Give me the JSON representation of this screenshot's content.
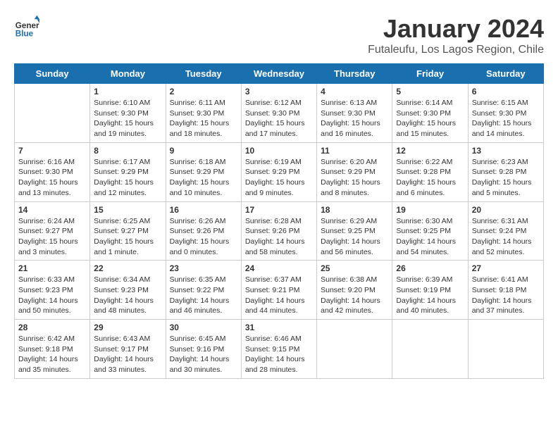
{
  "logo": {
    "general": "General",
    "blue": "Blue"
  },
  "title": "January 2024",
  "subtitle": "Futaleufu, Los Lagos Region, Chile",
  "days_of_week": [
    "Sunday",
    "Monday",
    "Tuesday",
    "Wednesday",
    "Thursday",
    "Friday",
    "Saturday"
  ],
  "weeks": [
    [
      {
        "day": "",
        "info": ""
      },
      {
        "day": "1",
        "info": "Sunrise: 6:10 AM\nSunset: 9:30 PM\nDaylight: 15 hours\nand 19 minutes."
      },
      {
        "day": "2",
        "info": "Sunrise: 6:11 AM\nSunset: 9:30 PM\nDaylight: 15 hours\nand 18 minutes."
      },
      {
        "day": "3",
        "info": "Sunrise: 6:12 AM\nSunset: 9:30 PM\nDaylight: 15 hours\nand 17 minutes."
      },
      {
        "day": "4",
        "info": "Sunrise: 6:13 AM\nSunset: 9:30 PM\nDaylight: 15 hours\nand 16 minutes."
      },
      {
        "day": "5",
        "info": "Sunrise: 6:14 AM\nSunset: 9:30 PM\nDaylight: 15 hours\nand 15 minutes."
      },
      {
        "day": "6",
        "info": "Sunrise: 6:15 AM\nSunset: 9:30 PM\nDaylight: 15 hours\nand 14 minutes."
      }
    ],
    [
      {
        "day": "7",
        "info": "Sunrise: 6:16 AM\nSunset: 9:30 PM\nDaylight: 15 hours\nand 13 minutes."
      },
      {
        "day": "8",
        "info": "Sunrise: 6:17 AM\nSunset: 9:29 PM\nDaylight: 15 hours\nand 12 minutes."
      },
      {
        "day": "9",
        "info": "Sunrise: 6:18 AM\nSunset: 9:29 PM\nDaylight: 15 hours\nand 10 minutes."
      },
      {
        "day": "10",
        "info": "Sunrise: 6:19 AM\nSunset: 9:29 PM\nDaylight: 15 hours\nand 9 minutes."
      },
      {
        "day": "11",
        "info": "Sunrise: 6:20 AM\nSunset: 9:29 PM\nDaylight: 15 hours\nand 8 minutes."
      },
      {
        "day": "12",
        "info": "Sunrise: 6:22 AM\nSunset: 9:28 PM\nDaylight: 15 hours\nand 6 minutes."
      },
      {
        "day": "13",
        "info": "Sunrise: 6:23 AM\nSunset: 9:28 PM\nDaylight: 15 hours\nand 5 minutes."
      }
    ],
    [
      {
        "day": "14",
        "info": "Sunrise: 6:24 AM\nSunset: 9:27 PM\nDaylight: 15 hours\nand 3 minutes."
      },
      {
        "day": "15",
        "info": "Sunrise: 6:25 AM\nSunset: 9:27 PM\nDaylight: 15 hours\nand 1 minute."
      },
      {
        "day": "16",
        "info": "Sunrise: 6:26 AM\nSunset: 9:26 PM\nDaylight: 15 hours\nand 0 minutes."
      },
      {
        "day": "17",
        "info": "Sunrise: 6:28 AM\nSunset: 9:26 PM\nDaylight: 14 hours\nand 58 minutes."
      },
      {
        "day": "18",
        "info": "Sunrise: 6:29 AM\nSunset: 9:25 PM\nDaylight: 14 hours\nand 56 minutes."
      },
      {
        "day": "19",
        "info": "Sunrise: 6:30 AM\nSunset: 9:25 PM\nDaylight: 14 hours\nand 54 minutes."
      },
      {
        "day": "20",
        "info": "Sunrise: 6:31 AM\nSunset: 9:24 PM\nDaylight: 14 hours\nand 52 minutes."
      }
    ],
    [
      {
        "day": "21",
        "info": "Sunrise: 6:33 AM\nSunset: 9:23 PM\nDaylight: 14 hours\nand 50 minutes."
      },
      {
        "day": "22",
        "info": "Sunrise: 6:34 AM\nSunset: 9:23 PM\nDaylight: 14 hours\nand 48 minutes."
      },
      {
        "day": "23",
        "info": "Sunrise: 6:35 AM\nSunset: 9:22 PM\nDaylight: 14 hours\nand 46 minutes."
      },
      {
        "day": "24",
        "info": "Sunrise: 6:37 AM\nSunset: 9:21 PM\nDaylight: 14 hours\nand 44 minutes."
      },
      {
        "day": "25",
        "info": "Sunrise: 6:38 AM\nSunset: 9:20 PM\nDaylight: 14 hours\nand 42 minutes."
      },
      {
        "day": "26",
        "info": "Sunrise: 6:39 AM\nSunset: 9:19 PM\nDaylight: 14 hours\nand 40 minutes."
      },
      {
        "day": "27",
        "info": "Sunrise: 6:41 AM\nSunset: 9:18 PM\nDaylight: 14 hours\nand 37 minutes."
      }
    ],
    [
      {
        "day": "28",
        "info": "Sunrise: 6:42 AM\nSunset: 9:18 PM\nDaylight: 14 hours\nand 35 minutes."
      },
      {
        "day": "29",
        "info": "Sunrise: 6:43 AM\nSunset: 9:17 PM\nDaylight: 14 hours\nand 33 minutes."
      },
      {
        "day": "30",
        "info": "Sunrise: 6:45 AM\nSunset: 9:16 PM\nDaylight: 14 hours\nand 30 minutes."
      },
      {
        "day": "31",
        "info": "Sunrise: 6:46 AM\nSunset: 9:15 PM\nDaylight: 14 hours\nand 28 minutes."
      },
      {
        "day": "",
        "info": ""
      },
      {
        "day": "",
        "info": ""
      },
      {
        "day": "",
        "info": ""
      }
    ]
  ]
}
